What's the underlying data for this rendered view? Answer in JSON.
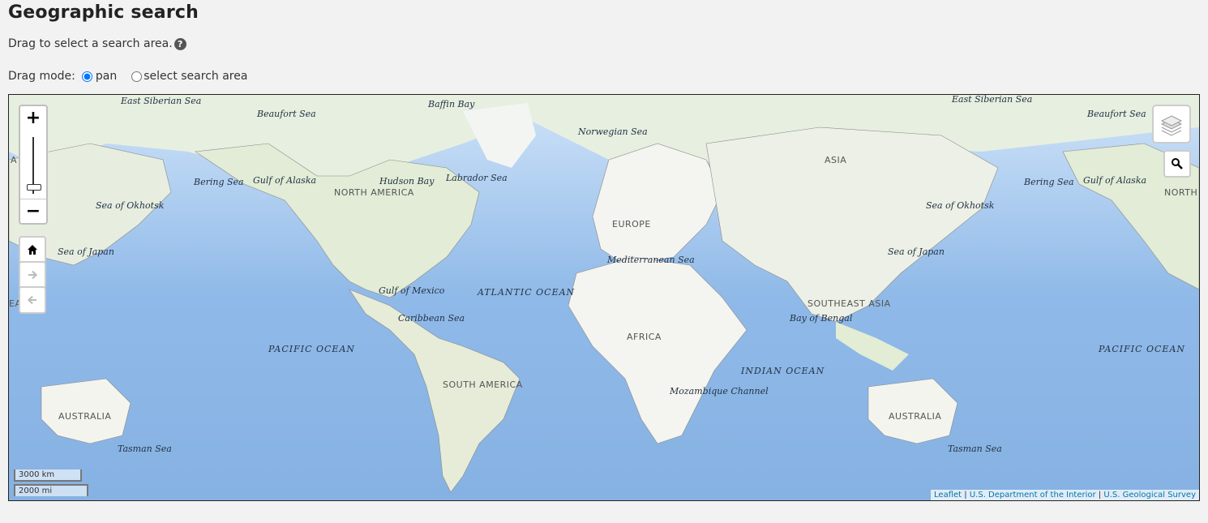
{
  "page": {
    "title": "Geographic search",
    "instructions": "Drag to select a search area.",
    "help_icon": "?"
  },
  "drag_mode": {
    "label": "Drag mode:",
    "options": [
      {
        "label": "pan",
        "selected": true
      },
      {
        "label": "select search area",
        "selected": false
      }
    ]
  },
  "map": {
    "controls": {
      "zoom_in": "+",
      "zoom_out": "−",
      "home_icon": "home-icon",
      "forward_icon": "arrow-right-icon",
      "back_icon": "arrow-left-icon",
      "layers_icon": "layers-icon",
      "search_icon": "search-icon"
    },
    "scale": {
      "km": "3000 km",
      "mi": "2000 mi"
    },
    "attribution": {
      "leaflet": "Leaflet",
      "sep": "|",
      "interior": "U.S. Department of the Interior",
      "usgs": "U.S. Geological Survey"
    },
    "labels": {
      "east_siberian_1": "East Siberian Sea",
      "beaufort_1": "Beaufort Sea",
      "baffin": "Baffin Bay",
      "norwegian": "Norwegian Sea",
      "east_siberian_2": "East Siberian Sea",
      "beaufort_2": "Beaufort Sea",
      "asia": "ASIA",
      "bering_1": "Bering Sea",
      "gulf_alaska_1": "Gulf of Alaska",
      "hudson": "Hudson Bay",
      "labrador": "Labrador Sea",
      "north_america_1": "NORTH AMERICA",
      "okhotsk_1": "Sea of Okhotsk",
      "bering_2": "Bering Sea",
      "gulf_alaska_2": "Gulf of Alaska",
      "north_america_2": "NORTH AMERICA",
      "okhotsk_2": "Sea of Okhotsk",
      "europe": "EUROPE",
      "japan_1": "Sea of Japan",
      "japan_2": "Sea of Japan",
      "mediterranean": "Mediterranean Sea",
      "atlantic": "ATLANTIC OCEAN",
      "gulf_mexico": "Gulf of Mexico",
      "caribbean": "Caribbean Sea",
      "southeast_asia": "SOUTHEAST ASIA",
      "bengal": "Bay of Bengal",
      "africa": "AFRICA",
      "pacific_1": "PACIFIC OCEAN",
      "pacific_2": "PACIFIC OCEAN",
      "indian": "INDIAN OCEAN",
      "south_america": "SOUTH AMERICA",
      "mozambique": "Mozambique Channel",
      "australia_1": "AUSTRALIA",
      "australia_2": "AUSTRALIA",
      "tasman_1": "Tasman Sea",
      "tasman_2": "Tasman Sea",
      "edge_a": "A",
      "edge_ea": "EA"
    }
  }
}
